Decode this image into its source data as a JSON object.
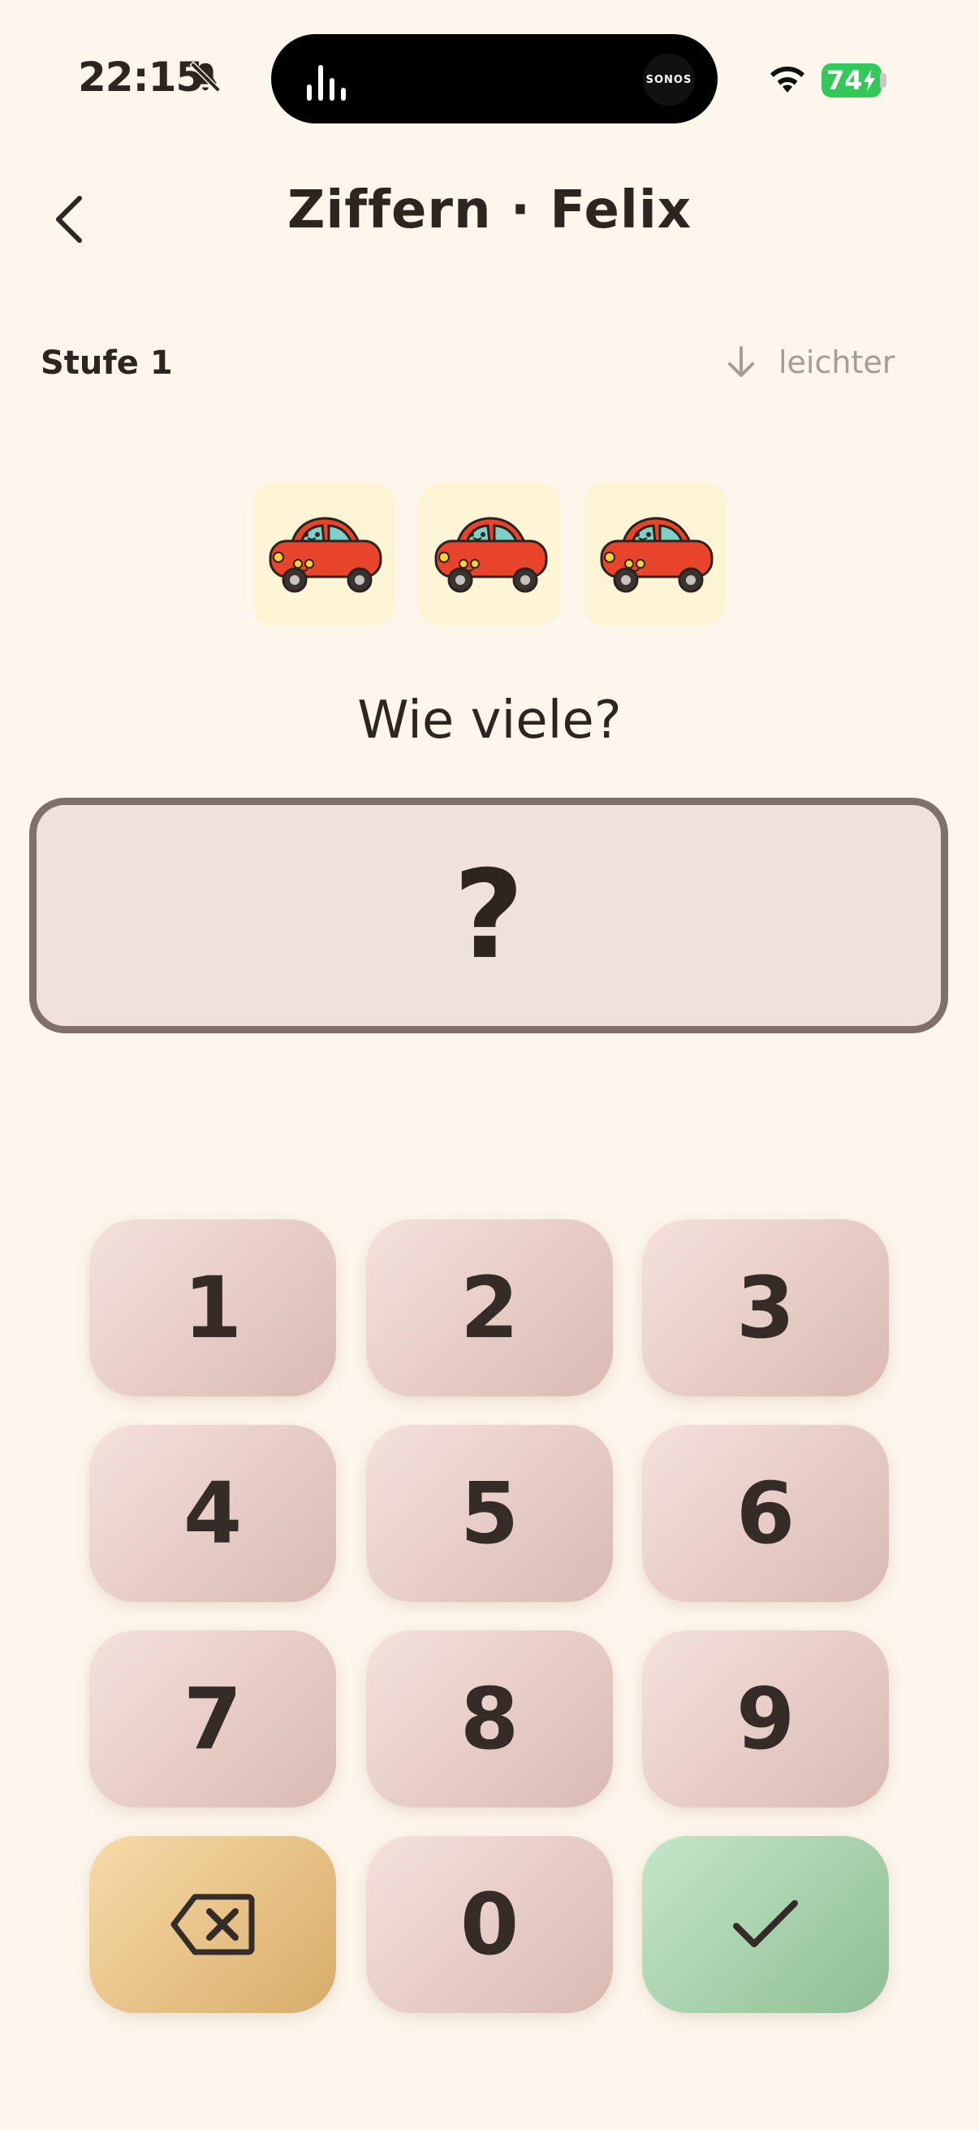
{
  "status_bar": {
    "time": "22:15",
    "live_activity": "SONOS",
    "battery": "74"
  },
  "header": {
    "title": "Ziffern · Felix"
  },
  "level": {
    "label": "Stufe 1",
    "easier_label": "leichter"
  },
  "items": {
    "icon": "red-car",
    "count": 3
  },
  "prompt": "Wie viele?",
  "answer": {
    "value": "?"
  },
  "keypad": {
    "keys": [
      "1",
      "2",
      "3",
      "4",
      "5",
      "6",
      "7",
      "8",
      "9",
      "0"
    ],
    "delete_icon": "backspace-icon",
    "confirm_icon": "check-icon"
  },
  "colors": {
    "background": "#fdf6ec",
    "key": "#e8cfc9",
    "delete_key": "#e8c086",
    "confirm_key": "#a9d4ae",
    "answer_border": "#80706a"
  }
}
